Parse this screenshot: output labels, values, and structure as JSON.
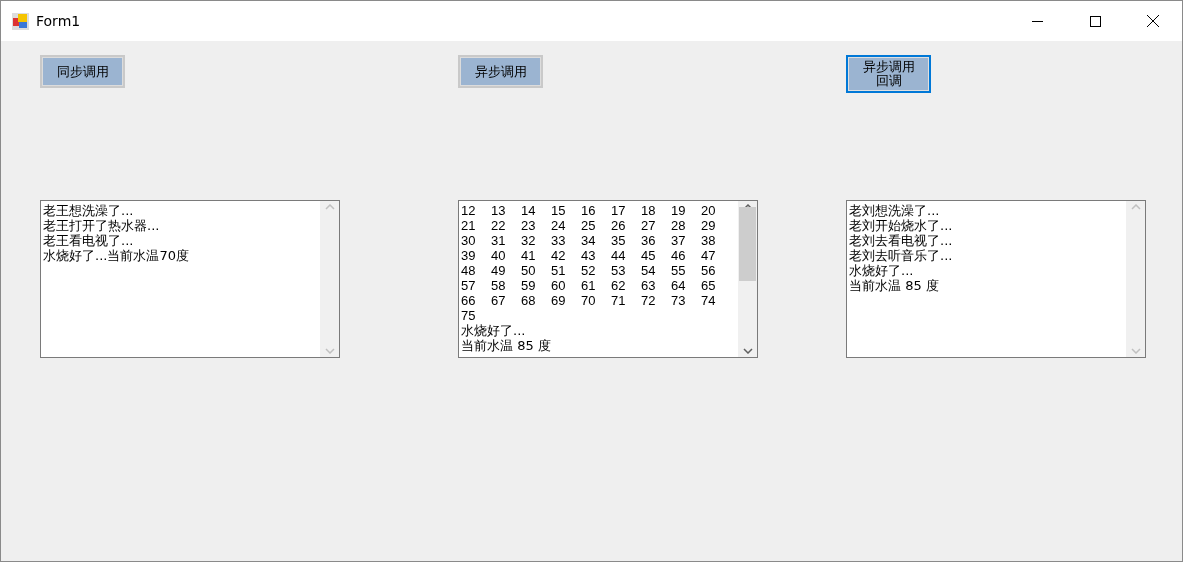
{
  "window": {
    "title": "Form1"
  },
  "panels": [
    {
      "button": {
        "label": "同步调用",
        "focused": false
      },
      "textbox": {
        "scrollable": false,
        "lines": [
          {
            "kind": "text",
            "text": "老王想洗澡了..."
          },
          {
            "kind": "text",
            "text": "老王打开了热水器..."
          },
          {
            "kind": "text",
            "text": "老王看电视了..."
          },
          {
            "kind": "text",
            "text": "水烧好了...当前水温70度"
          }
        ]
      }
    },
    {
      "button": {
        "label": "异步调用",
        "focused": false
      },
      "textbox": {
        "scrollable": true,
        "lines": [
          {
            "kind": "numbers",
            "cells": [
              "12",
              "13",
              "14",
              "15",
              "16",
              "17",
              "18",
              "19",
              "20"
            ]
          },
          {
            "kind": "numbers",
            "cells": [
              "21",
              "22",
              "23",
              "24",
              "25",
              "26",
              "27",
              "28",
              "29"
            ]
          },
          {
            "kind": "numbers",
            "cells": [
              "30",
              "31",
              "32",
              "33",
              "34",
              "35",
              "36",
              "37",
              "38"
            ]
          },
          {
            "kind": "numbers",
            "cells": [
              "39",
              "40",
              "41",
              "42",
              "43",
              "44",
              "45",
              "46",
              "47"
            ]
          },
          {
            "kind": "numbers",
            "cells": [
              "48",
              "49",
              "50",
              "51",
              "52",
              "53",
              "54",
              "55",
              "56"
            ]
          },
          {
            "kind": "numbers",
            "cells": [
              "57",
              "58",
              "59",
              "60",
              "61",
              "62",
              "63",
              "64",
              "65"
            ]
          },
          {
            "kind": "numbers",
            "cells": [
              "66",
              "67",
              "68",
              "69",
              "70",
              "71",
              "72",
              "73",
              "74"
            ]
          },
          {
            "kind": "numbers",
            "cells": [
              "75"
            ]
          },
          {
            "kind": "text",
            "text": "水烧好了..."
          },
          {
            "kind": "text",
            "text": "当前水温 85 度"
          }
        ]
      }
    },
    {
      "button": {
        "label": "异步调用回调",
        "focused": true
      },
      "textbox": {
        "scrollable": false,
        "lines": [
          {
            "kind": "text",
            "text": "老刘想洗澡了..."
          },
          {
            "kind": "text",
            "text": "老刘开始烧水了..."
          },
          {
            "kind": "text",
            "text": "老刘去看电视了..."
          },
          {
            "kind": "text",
            "text": "老刘去听音乐了..."
          },
          {
            "kind": "text",
            "text": "水烧好了..."
          },
          {
            "kind": "text",
            "text": "当前水温 85 度"
          }
        ]
      }
    }
  ]
}
